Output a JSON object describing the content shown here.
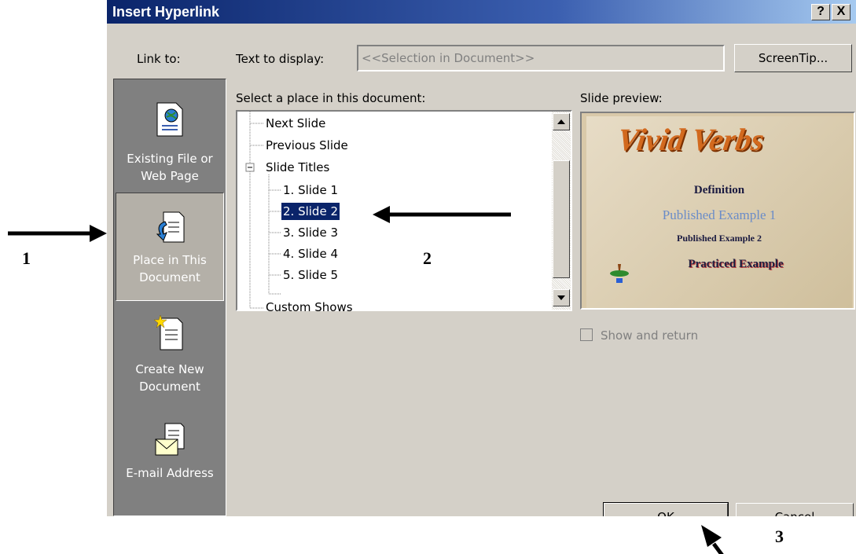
{
  "dialog": {
    "title": "Insert Hyperlink",
    "help_button": "?",
    "close_button": "X",
    "link_to_label": "Link to:",
    "text_to_display_label": "Text to display:",
    "text_to_display_value": "<<Selection in Document>>",
    "screentip_button": "ScreenTip...",
    "select_place_label": "Select a place in this document:",
    "slide_preview_label": "Slide preview:",
    "show_and_return_label": "Show and return",
    "ok_button": "OK",
    "cancel_button": "Cancel"
  },
  "sidebar": {
    "items": [
      {
        "line1": "Existing File or",
        "line2": "Web Page",
        "icon": "existing-file-icon"
      },
      {
        "line1": "Place in This",
        "line2": "Document",
        "icon": "place-in-document-icon"
      },
      {
        "line1": "Create New",
        "line2": "Document",
        "icon": "create-new-document-icon"
      },
      {
        "line1": "E-mail Address",
        "line2": "",
        "icon": "email-icon"
      }
    ],
    "selected_index": 1
  },
  "tree": {
    "items": [
      {
        "label": "Next Slide"
      },
      {
        "label": "Previous Slide"
      },
      {
        "label": "Slide Titles"
      },
      {
        "label": "1. Slide 1"
      },
      {
        "label": "2. Slide 2"
      },
      {
        "label": "3. Slide 3"
      },
      {
        "label": "4. Slide 4"
      },
      {
        "label": "5. Slide 5"
      },
      {
        "label": "Custom Shows"
      }
    ],
    "selected": "2. Slide 2",
    "expander": "−"
  },
  "preview": {
    "title": "Vivid Verbs",
    "lines": [
      "Definition",
      "Published Example 1",
      "Published Example 2",
      "Practiced Example"
    ]
  },
  "annotations": {
    "one": "1",
    "two": "2",
    "three": "3"
  },
  "colors": {
    "title_bar": "#0a246a",
    "dialog_bg": "#d4d0c8",
    "sidebar_bg": "#808080",
    "selection": "#0a246a"
  }
}
